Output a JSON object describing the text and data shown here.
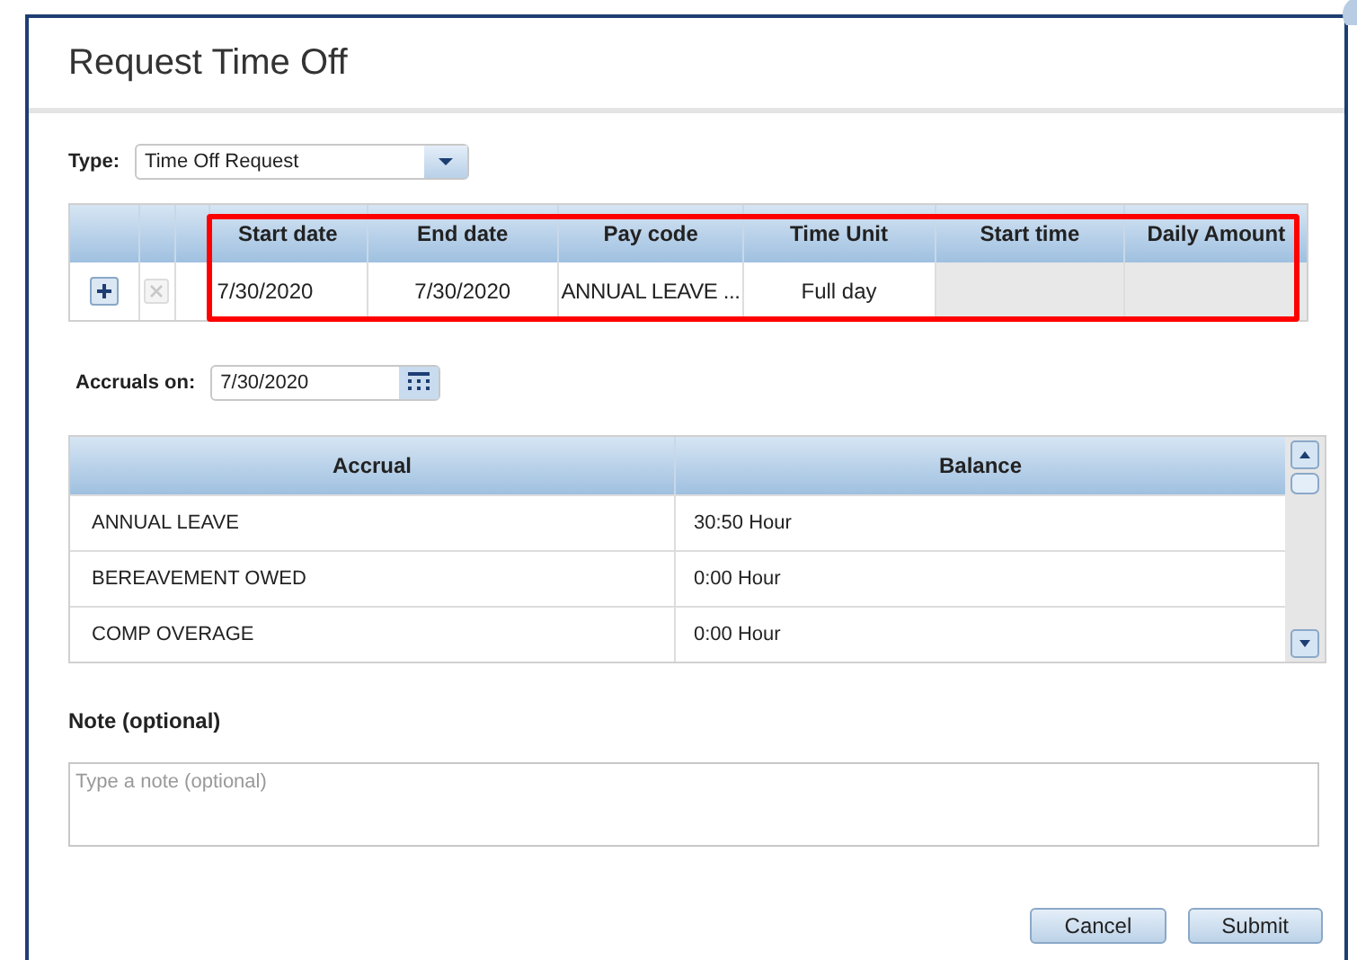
{
  "dialog": {
    "title": "Request Time Off"
  },
  "type_field": {
    "label": "Type:",
    "value": "Time Off Request"
  },
  "request_table": {
    "columns": [
      "Start date",
      "End date",
      "Pay code",
      "Time Unit",
      "Start time",
      "Daily Amount"
    ],
    "rows": [
      {
        "cells": [
          "7/30/2020",
          "7/30/2020",
          "ANNUAL LEAVE ...",
          "Full day",
          "",
          ""
        ],
        "delete_disabled": true
      }
    ]
  },
  "accruals_on": {
    "label": "Accruals on:",
    "value": "7/30/2020"
  },
  "accrual_table": {
    "columns": [
      "Accrual",
      "Balance"
    ],
    "rows": [
      {
        "cells": [
          "ANNUAL LEAVE",
          "30:50 Hour"
        ]
      },
      {
        "cells": [
          "BEREAVEMENT OWED",
          "0:00 Hour"
        ]
      },
      {
        "cells": [
          "COMP OVERAGE",
          "0:00 Hour"
        ]
      }
    ]
  },
  "note": {
    "label": "Note (optional)",
    "placeholder": "Type a note (optional)"
  },
  "buttons": [
    "Cancel",
    "Submit"
  ]
}
